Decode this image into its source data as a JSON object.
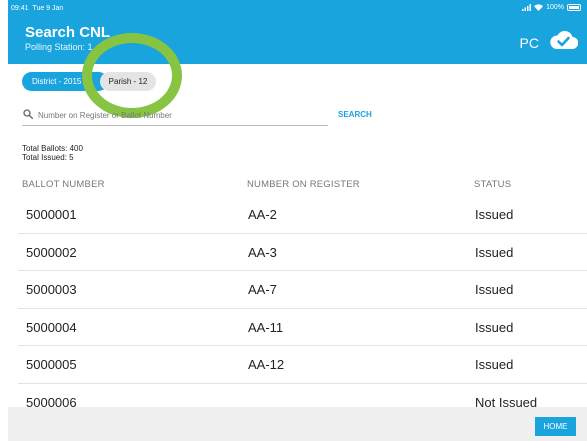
{
  "status_bar": {
    "time": "09:41",
    "date": "Tue 9 Jan",
    "battery": "100%"
  },
  "header": {
    "title": "Search CNL",
    "subtitle": "Polling Station: 1",
    "pc_label": "PC"
  },
  "chips": {
    "district": "District - 2015",
    "parish": "Parish - 12"
  },
  "search": {
    "placeholder": "Number on Register or Ballot Number",
    "button_label": "SEARCH"
  },
  "totals": {
    "ballots": "Total Ballots: 400",
    "issued": "Total Issued: 5"
  },
  "table": {
    "columns": [
      "BALLOT NUMBER",
      "NUMBER ON REGISTER",
      "STATUS"
    ],
    "rows": [
      [
        "5000001",
        "AA-2",
        "Issued"
      ],
      [
        "5000002",
        "AA-3",
        "Issued"
      ],
      [
        "5000003",
        "AA-7",
        "Issued"
      ],
      [
        "5000004",
        "AA-11",
        "Issued"
      ],
      [
        "5000005",
        "AA-12",
        "Issued"
      ],
      [
        "5000006",
        "",
        "Not Issued"
      ]
    ]
  },
  "footer": {
    "home_label": "HOME"
  },
  "colors": {
    "accent": "#1aa4de",
    "highlight": "#86c441"
  }
}
